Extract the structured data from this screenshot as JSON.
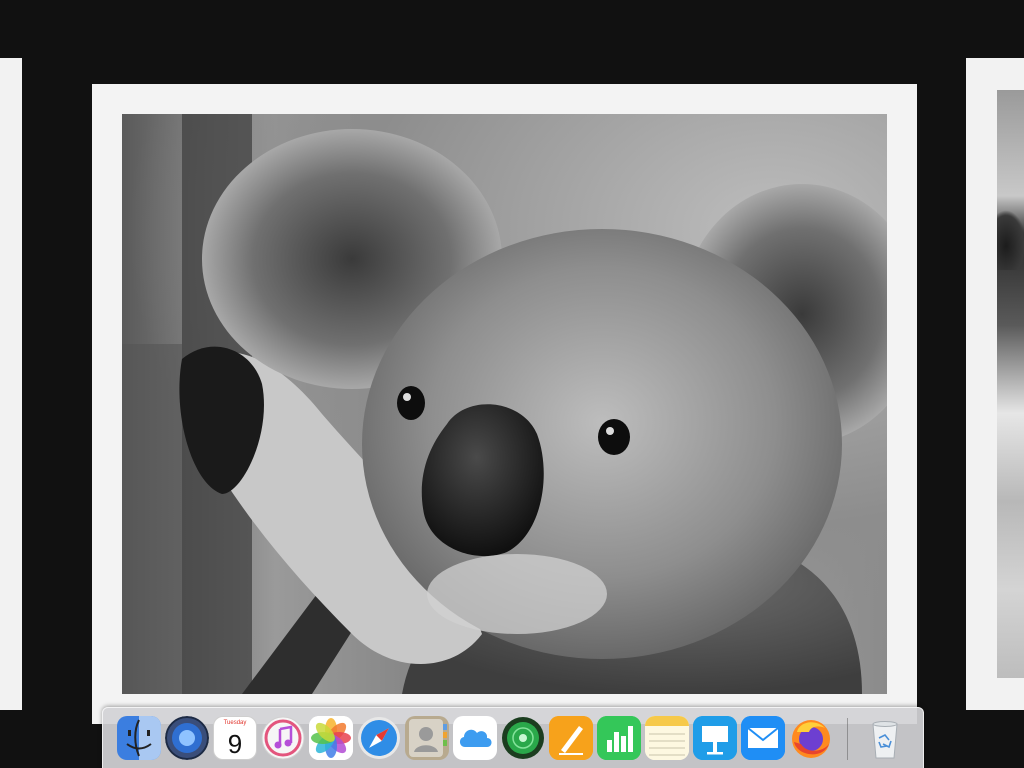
{
  "viewer": {
    "background_color": "#111111",
    "frame_color": "#f3f3f3"
  },
  "slides": {
    "current": {
      "icon": "koala-photo",
      "tone": "grayscale"
    },
    "previous": {
      "icon": "photo-slide"
    },
    "next": {
      "icon": "photo-slide"
    }
  },
  "dock": {
    "items": [
      {
        "icon": "finder-icon"
      },
      {
        "icon": "launchpad-icon"
      },
      {
        "icon": "calendar-icon",
        "weekday": "Tuesday",
        "day": "9"
      },
      {
        "icon": "itunes-icon"
      },
      {
        "icon": "photos-icon"
      },
      {
        "icon": "safari-icon"
      },
      {
        "icon": "contacts-icon"
      },
      {
        "icon": "icloud-icon"
      },
      {
        "icon": "find-my-icon"
      },
      {
        "icon": "pages-icon"
      },
      {
        "icon": "numbers-icon"
      },
      {
        "icon": "notes-icon"
      },
      {
        "icon": "keynote-icon"
      },
      {
        "icon": "mail-icon"
      },
      {
        "icon": "firefox-icon"
      },
      {
        "icon": "trash-icon"
      }
    ],
    "accent_colors": {
      "calendar_red": "#e0342c",
      "mail_blue": "#1f8ef5",
      "numbers_green": "#34c759",
      "pages_orange": "#f7a21b"
    }
  }
}
